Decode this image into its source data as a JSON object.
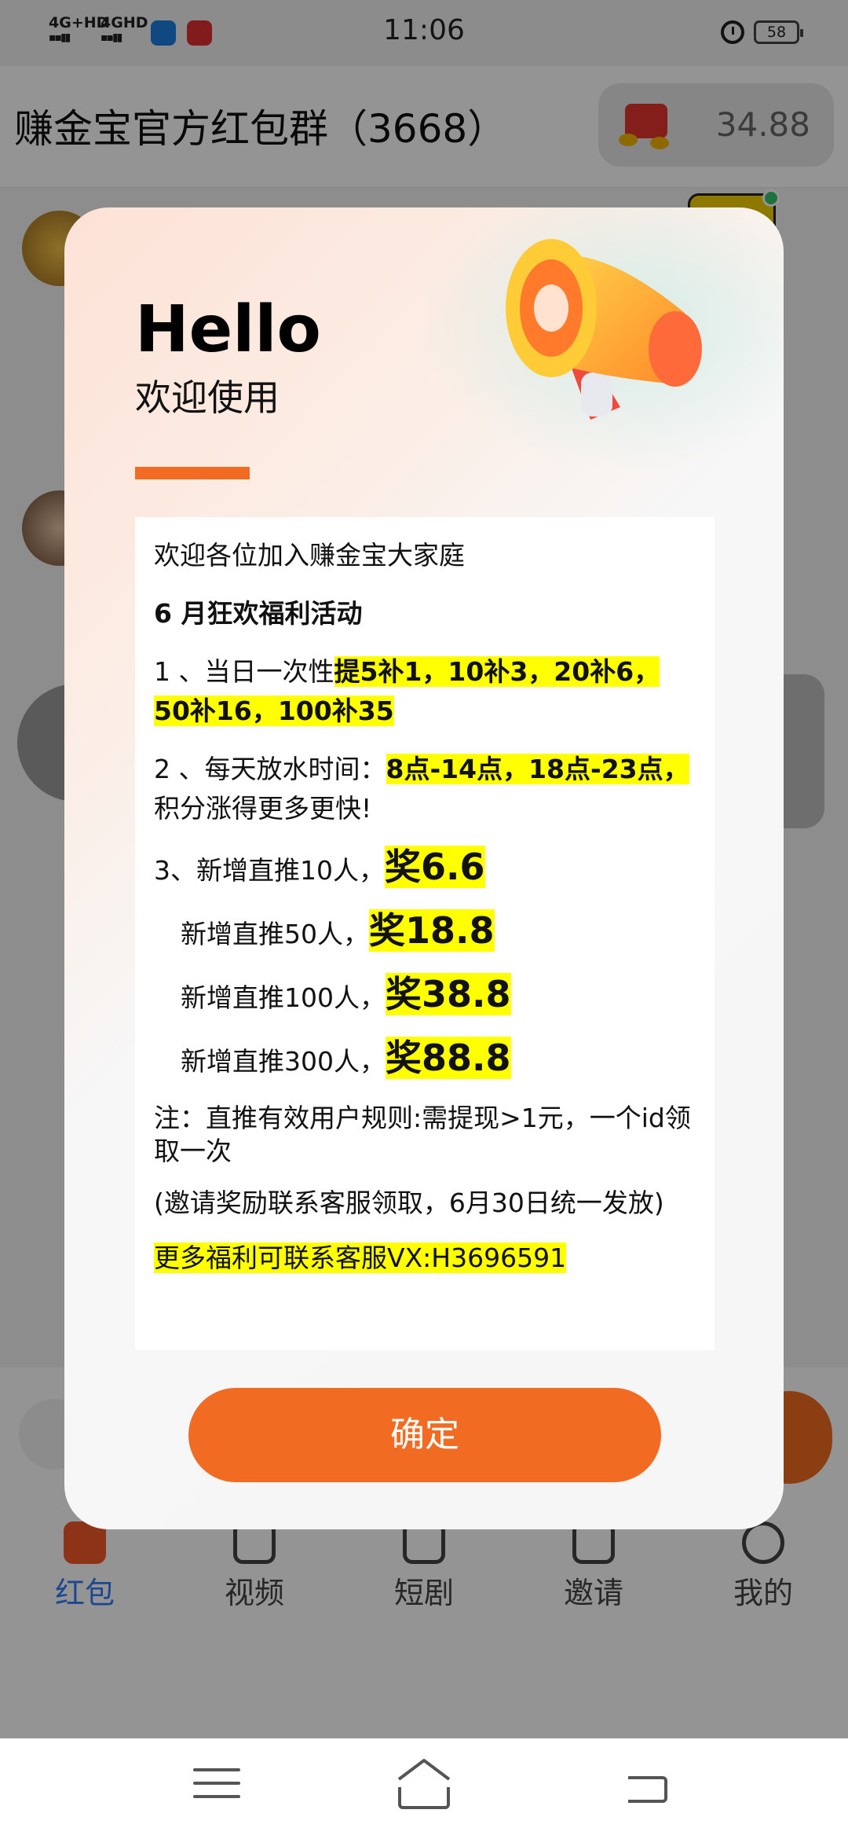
{
  "status_bar": {
    "network1": "4G+HD",
    "network2": "4GHD",
    "time": "11:06",
    "battery": "58"
  },
  "header": {
    "title": "赚金宝官方红包群（3668）",
    "balance": "34.88"
  },
  "tabs": [
    {
      "label": "红包",
      "icon": "red-packet-icon",
      "active": true
    },
    {
      "label": "视频",
      "icon": "video-icon",
      "active": false
    },
    {
      "label": "短剧",
      "icon": "drama-icon",
      "active": false
    },
    {
      "label": "邀请",
      "icon": "invite-icon",
      "active": false
    },
    {
      "label": "我的",
      "icon": "profile-icon",
      "active": false
    }
  ],
  "modal": {
    "hello": "Hello",
    "welcome": "欢迎使用",
    "notice": {
      "intro": "欢迎各位加入赚金宝大家庭",
      "event_title": "6 月狂欢福利活动",
      "item1_prefix": "1 、当日一次性",
      "item1_highlight": "提5补1，10补3，20补6，50补16，100补35",
      "item2_prefix": "2 、每天放水时间：",
      "item2_highlight": "8点-14点，18点-23点，",
      "item2_suffix": "积分涨得更多更快!",
      "reward1_prefix": "3、新增直推10人，",
      "reward1_value": "奖6.6",
      "reward2_prefix": "新增直推50人，",
      "reward2_value": "奖18.8",
      "reward3_prefix": "新增直推100人，",
      "reward3_value": "奖38.8",
      "reward4_prefix": "新增直推300人，",
      "reward4_value": "奖88.8",
      "note": "注：直推有效用户规则:需提现>1元，一个id领取一次",
      "payout": "(邀请奖励联系客服领取，6月30日统一发放)",
      "contact": "更多福利可联系客服VX:H3696591"
    },
    "confirm_label": "确定"
  },
  "colors": {
    "accent": "#f26b22",
    "highlight": "#ffff00",
    "active_tab": "#2f7df6"
  }
}
